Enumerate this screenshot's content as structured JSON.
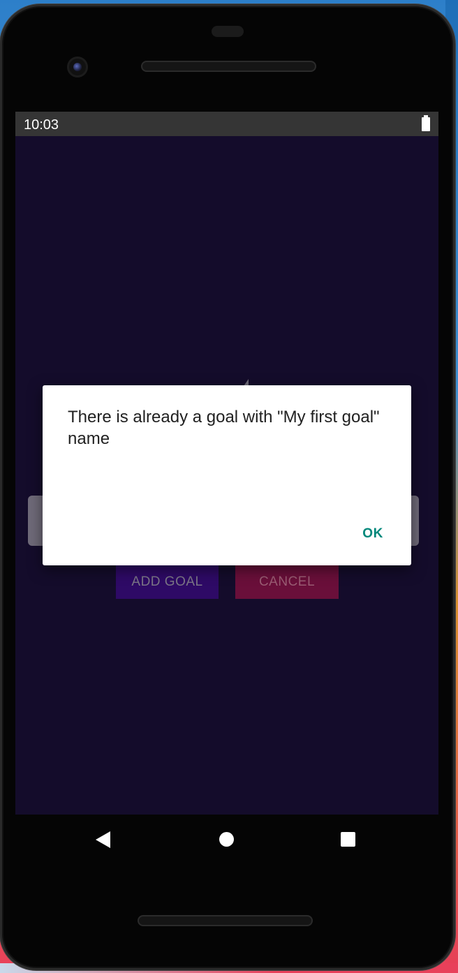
{
  "status_bar": {
    "time": "10:03",
    "battery_icon": "battery-full-icon"
  },
  "form": {
    "add_goal_label": "ADD GOAL",
    "cancel_label": "CANCEL"
  },
  "dialog": {
    "message": "There is already a goal with \"My first goal\" name",
    "ok_label": "OK"
  },
  "nav_bar": {
    "back_icon": "back-triangle-icon",
    "home_icon": "home-circle-icon",
    "recents_icon": "recents-square-icon"
  },
  "colors": {
    "app_background": "#140c2b",
    "add_button": "#2e0a66",
    "cancel_button": "#6a0f3a",
    "dialog_accent": "#00877a"
  }
}
